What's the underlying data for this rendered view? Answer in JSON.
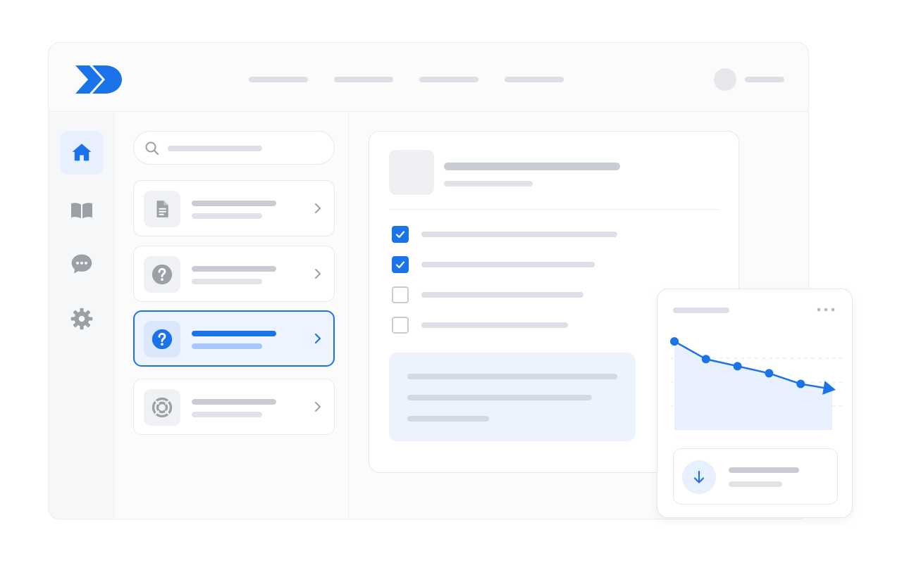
{
  "colors": {
    "accent": "#1a73e8",
    "accent_light": "#e8f0fe",
    "icon_gray": "#9aa0a6",
    "skeleton": "#dcdfe5"
  },
  "brand": {
    "logo_icon": "double-chevron-logo"
  },
  "header": {
    "nav_items": [
      {
        "name": "nav-item-1",
        "placeholder": true
      },
      {
        "name": "nav-item-2",
        "placeholder": true
      },
      {
        "name": "nav-item-3",
        "placeholder": true
      },
      {
        "name": "nav-item-4",
        "placeholder": true
      }
    ],
    "user": {
      "avatar_icon": "avatar",
      "name_placeholder": true
    }
  },
  "rail": {
    "items": [
      {
        "icon": "home-icon",
        "active": true
      },
      {
        "icon": "book-icon",
        "active": false
      },
      {
        "icon": "chat-icon",
        "active": false
      },
      {
        "icon": "gear-icon",
        "active": false
      }
    ]
  },
  "list": {
    "search_icon": "search-icon",
    "items": [
      {
        "icon": "document-icon",
        "selected": false
      },
      {
        "icon": "help-icon",
        "selected": false
      },
      {
        "icon": "help-icon",
        "selected": true
      },
      {
        "icon": "lifebuoy-icon",
        "selected": false
      }
    ]
  },
  "detail": {
    "checklist": [
      {
        "checked": true
      },
      {
        "checked": true
      },
      {
        "checked": false
      },
      {
        "checked": false
      }
    ]
  },
  "trend_card": {
    "more_icon": "more-horizontal-icon",
    "stat_icon": "arrow-down-icon",
    "chart": {
      "type": "line",
      "trend": "decreasing",
      "values": [
        5,
        4,
        3.6,
        3.2,
        2.6,
        2.3
      ],
      "grid": "dashed-horizontal"
    }
  }
}
